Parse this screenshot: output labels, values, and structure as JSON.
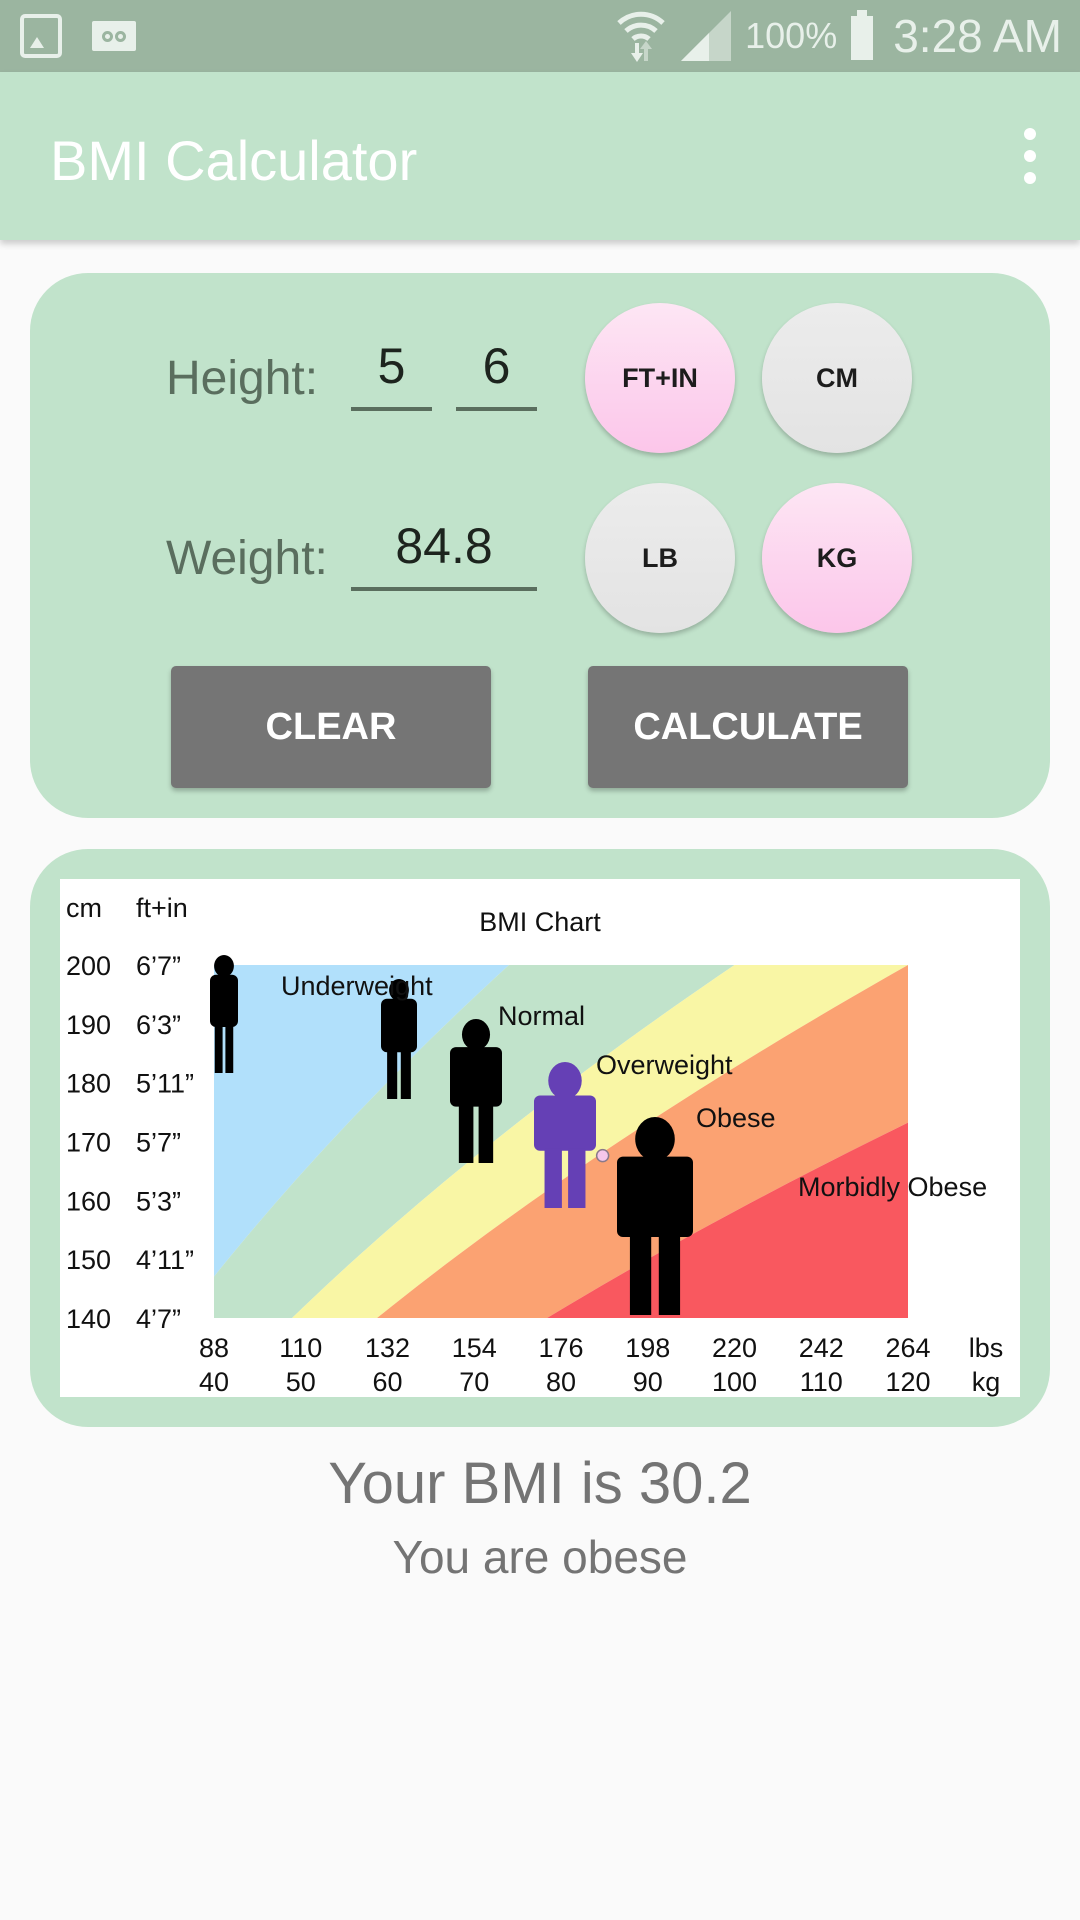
{
  "status_bar": {
    "left_icons": [
      "gallery-icon",
      "voicemail-icon"
    ],
    "right_icons": [
      "wifi-icon",
      "signal-icon",
      "battery-icon"
    ],
    "battery": "100%",
    "time": "3:28 AM"
  },
  "app_bar": {
    "title": "BMI Calculator",
    "menu_icon": "overflow-menu-icon"
  },
  "form": {
    "height_label": "Height:",
    "height_feet": "5",
    "height_inches": "6",
    "weight_label": "Weight:",
    "weight_value": "84.8",
    "height_units": [
      {
        "label": "FT+IN",
        "selected": true
      },
      {
        "label": "CM",
        "selected": false
      }
    ],
    "weight_units": [
      {
        "label": "LB",
        "selected": false
      },
      {
        "label": "KG",
        "selected": true
      }
    ],
    "clear_label": "CLEAR",
    "calculate_label": "CALCULATE"
  },
  "colors": {
    "accent_green": "#c1e3cb",
    "status_bar": "#9bb5a0",
    "selected_unit": "#fcc6ea",
    "unselected_unit": "#e6e6e6",
    "button_gray": "#757575",
    "underweight": "#b1e0fb",
    "normal": "#c1e3cb",
    "overweight": "#f9f6a5",
    "obese": "#fba272",
    "morbidly_obese": "#f9585f",
    "obese_figure": "#6540b5",
    "marker": "#f6c7ea"
  },
  "chart_data": {
    "type": "area",
    "title": "BMI Chart",
    "y_header_cm": "cm",
    "y_header_ftin": "ft+in",
    "y_ticks_cm": [
      "200",
      "190",
      "180",
      "170",
      "160",
      "150",
      "140"
    ],
    "y_ticks_ftin": [
      "6’7”",
      "6’3”",
      "5’11”",
      "5’7”",
      "5’3”",
      "4’11”",
      "4’7”"
    ],
    "x_ticks_lbs": [
      "88",
      "110",
      "132",
      "154",
      "176",
      "198",
      "220",
      "242",
      "264"
    ],
    "x_ticks_kg": [
      "40",
      "50",
      "60",
      "70",
      "80",
      "90",
      "100",
      "110",
      "120"
    ],
    "x_unit_lbs": "lbs",
    "x_unit_kg": "kg",
    "xlim_kg": [
      40,
      120
    ],
    "ylim_cm": [
      140,
      200
    ],
    "categories": [
      {
        "name": "Underweight",
        "bmi_max": 18.5
      },
      {
        "name": "Normal",
        "bmi_max": 25
      },
      {
        "name": "Overweight",
        "bmi_max": 30
      },
      {
        "name": "Obese",
        "bmi_max": 40
      },
      {
        "name": "Morbidly Obese",
        "bmi_max": null
      }
    ],
    "marker": {
      "weight_kg": 84.8,
      "height_cm": 167.6
    }
  },
  "result": {
    "bmi_text": "Your BMI is 30.2",
    "category_text": "You are obese"
  }
}
